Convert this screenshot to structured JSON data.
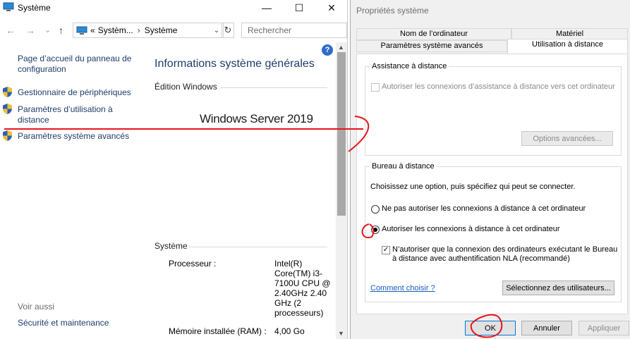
{
  "left_window": {
    "title": "Système",
    "min_symbol": "—",
    "max_symbol": "☐",
    "close_symbol": "✕",
    "nav": {
      "back": "←",
      "forward": "→",
      "dropdown": "⌄",
      "up": "↑"
    },
    "address": {
      "crumb_prefix": "«",
      "crumb1": "Systèm...",
      "separator": "›",
      "crumb2": "Système",
      "dropdown": "⌄",
      "refresh": "↻"
    },
    "search": {
      "placeholder": "Rechercher"
    },
    "sidebar": {
      "home_link": "Page d’accueil du panneau de configuration",
      "items": [
        {
          "label": "Gestionnaire de périphériques",
          "icon": "shield-icon"
        },
        {
          "label": "Paramètres d’utilisation à distance",
          "icon": "shield-icon"
        },
        {
          "label": "Paramètres système avancés",
          "icon": "shield-icon"
        }
      ],
      "see_also": "Voir aussi",
      "security_link": "Sécurité et maintenance"
    },
    "help": "?",
    "main": {
      "title": "Informations système générales",
      "edition_header": "Édition Windows",
      "os_name": "Windows Server 2019",
      "system_header": "Système",
      "processor_label": "Processeur :",
      "processor_value": "Intel(R) Core(TM) i3-7100U CPU @ 2.40GHz 2.40 GHz (2 processeurs)",
      "ram_label": "Mémoire installée (RAM) :",
      "ram_value": "4,00 Go"
    }
  },
  "dialog": {
    "title": "Propriétés système",
    "tabs": {
      "computer_name": "Nom de l’ordinateur",
      "hardware": "Matériel",
      "advanced": "Paramètres système avancés",
      "remote": "Utilisation à distance"
    },
    "assistance": {
      "title": "Assistance à distance",
      "checkbox_label": "Autoriser les connexions d’assistance à distance vers cet ordinateur",
      "checked": false,
      "advanced_button": "Options avancées..."
    },
    "remote_desktop": {
      "title": "Bureau à distance",
      "instructions": "Choisissez une option, puis spécifiez qui peut se connecter.",
      "option_deny": "Ne pas autoriser les connexions à distance à cet ordinateur",
      "option_allow": "Autoriser les connexions à distance à cet ordinateur",
      "selected": "allow",
      "nla_label": "N’autoriser que la connexion des ordinateurs exécutant le Bureau à distance avec authentification NLA (recommandé)",
      "nla_checked": true,
      "nla_check_mark": "✓",
      "help_link": "Comment choisir ?",
      "select_users_button": "Sélectionnez des utilisateurs..."
    },
    "buttons": {
      "ok": "OK",
      "cancel": "Annuler",
      "apply": "Appliquer"
    }
  },
  "annotation_color": "#e8141b"
}
